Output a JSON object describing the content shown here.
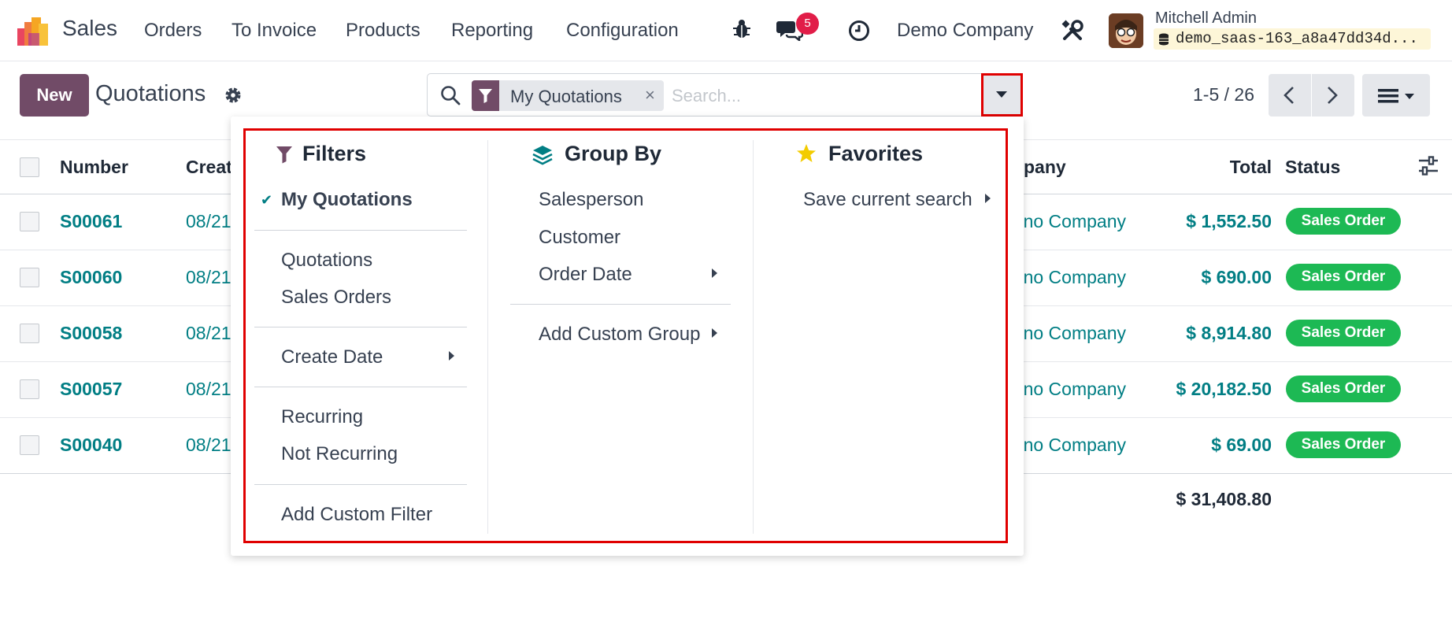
{
  "app": {
    "name": "Sales"
  },
  "menu": [
    "Orders",
    "To Invoice",
    "Products",
    "Reporting",
    "Configuration"
  ],
  "systray": {
    "messages_count": "5",
    "company": "Demo Company",
    "user_name": "Mitchell Admin",
    "database": "demo_saas-163_a8a47dd34d..."
  },
  "control_panel": {
    "new_label": "New",
    "title": "Quotations",
    "search": {
      "facet_label": "My Quotations",
      "facet_remove": "×",
      "placeholder": "Search..."
    },
    "pager": "1-5 / 26"
  },
  "table": {
    "headers": {
      "number": "Number",
      "create_date": "Creat",
      "company": "pany",
      "total": "Total",
      "status": "Status"
    },
    "rows": [
      {
        "number": "S00061",
        "date": "08/21",
        "company": "no Company",
        "total": "$ 1,552.50",
        "status": "Sales Order"
      },
      {
        "number": "S00060",
        "date": "08/21",
        "company": "no Company",
        "total": "$ 690.00",
        "status": "Sales Order"
      },
      {
        "number": "S00058",
        "date": "08/21",
        "company": "no Company",
        "total": "$ 8,914.80",
        "status": "Sales Order"
      },
      {
        "number": "S00057",
        "date": "08/21",
        "company": "no Company",
        "total": "$ 20,182.50",
        "status": "Sales Order"
      },
      {
        "number": "S00040",
        "date": "08/21",
        "company": "no Company",
        "total": "$ 69.00",
        "status": "Sales Order"
      }
    ],
    "grand_total": "$ 31,408.80"
  },
  "dropdown": {
    "filters": {
      "title": "Filters",
      "my_quotations": "My Quotations",
      "quotations": "Quotations",
      "sales_orders": "Sales Orders",
      "create_date": "Create Date",
      "recurring": "Recurring",
      "not_recurring": "Not Recurring",
      "add_custom_filter": "Add Custom Filter"
    },
    "group_by": {
      "title": "Group By",
      "salesperson": "Salesperson",
      "customer": "Customer",
      "order_date": "Order Date",
      "add_custom_group": "Add Custom Group"
    },
    "favorites": {
      "title": "Favorites",
      "save_current_search": "Save current search"
    }
  },
  "colors": {
    "brand": "#714b67",
    "link": "#017e84",
    "status_green": "#1db954",
    "highlight_red": "#e00000",
    "badge_red": "#e11d48"
  }
}
